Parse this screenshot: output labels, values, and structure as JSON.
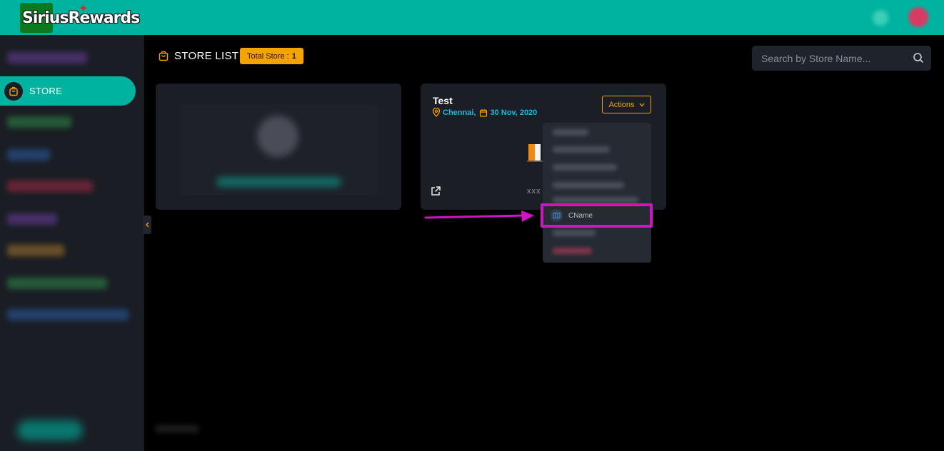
{
  "brand": {
    "logo_text": "SiriusRewards"
  },
  "sidebar": {
    "active_item": {
      "label": "STORE",
      "icon": "shopping-bag-icon"
    }
  },
  "header": {
    "title": "STORE LIST",
    "badge_label": "Total Store :",
    "badge_count": "1"
  },
  "search": {
    "placeholder": "Search by Store Name..."
  },
  "store_card": {
    "name": "Test",
    "location": "Chennai,",
    "date": "30 Nov, 2020",
    "actions_label": "Actions",
    "code": "xxx"
  },
  "actions_menu": {
    "highlighted_item": "CName"
  },
  "colors": {
    "topbar": "#00b3a0",
    "accent_orange": "#f5a300",
    "highlight_magenta": "#d312c5",
    "link_blue": "#20b7e0"
  }
}
